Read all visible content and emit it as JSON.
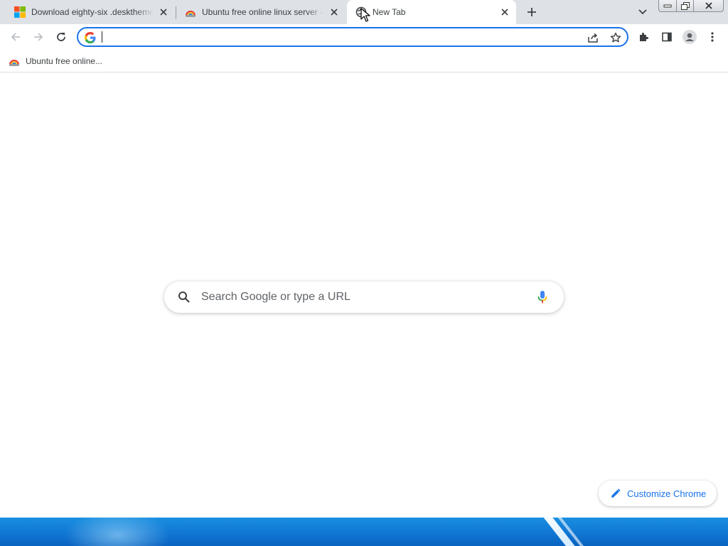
{
  "tabs": [
    {
      "title": "Download eighty-six .deskthemepack",
      "active": false,
      "favicon": "microsoft-logo-icon"
    },
    {
      "title": "Ubuntu free online linux server - ",
      "active": false,
      "favicon": "rainbow-cloud-icon"
    },
    {
      "title": "New Tab",
      "active": true,
      "favicon": "globe-icon"
    }
  ],
  "toolbar": {
    "back": "arrow-left-icon",
    "forward": "arrow-right-icon",
    "reload": "reload-icon",
    "omnibox_value": "",
    "share": "share-icon",
    "bookmark": "star-icon",
    "extensions": "puzzle-icon",
    "side_panel": "side-panel-icon",
    "profile": "profile-icon",
    "menu": "kebab-menu-icon"
  },
  "bookmarks": [
    {
      "label": "Ubuntu free online...",
      "favicon": "rainbow-cloud-icon"
    }
  ],
  "ntp": {
    "search_placeholder": "Search Google or type a URL",
    "customize_label": "Customize Chrome"
  },
  "colors": {
    "accent": "#1a73e8",
    "tabstrip": "#dee1e6",
    "text": "#3c4043"
  }
}
